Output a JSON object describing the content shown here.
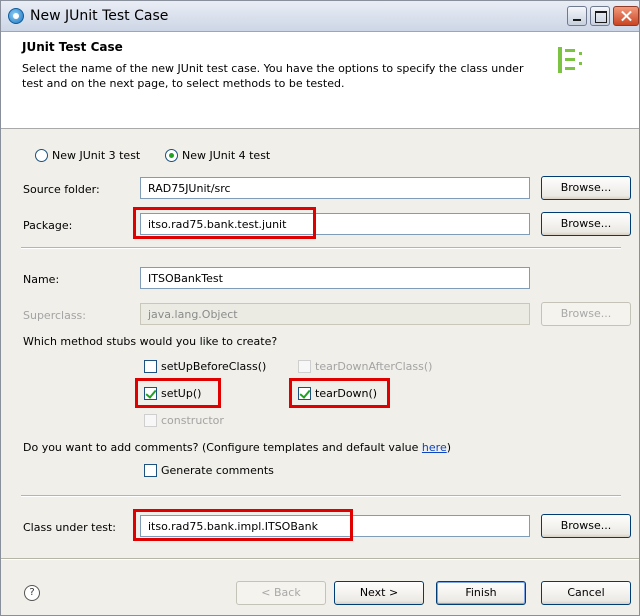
{
  "window": {
    "title": "New JUnit Test Case"
  },
  "header": {
    "title": "JUnit Test Case",
    "description": "Select the name of the new JUnit test case. You have the options to specify the class under test and on the next page, to select methods to be tested."
  },
  "version": {
    "option1": "New JUnit 3 test",
    "option2": "New JUnit 4 test",
    "selected": "New JUnit 4 test"
  },
  "fields": {
    "source_folder_label": "Source folder:",
    "source_folder_value": "RAD75JUnit/src",
    "package_label": "Package:",
    "package_value": "itso.rad75.bank.test.junit",
    "name_label": "Name:",
    "name_value": "ITSOBankTest",
    "superclass_label": "Superclass:",
    "superclass_value": "java.lang.Object",
    "class_under_test_label": "Class under test:",
    "class_under_test_value": "itso.rad75.bank.impl.ITSOBank"
  },
  "browse_label": "Browse...",
  "stubs": {
    "question": "Which method stubs would you like to create?",
    "setUpBeforeClass": "setUpBeforeClass()",
    "tearDownAfterClass": "tearDownAfterClass()",
    "setUp": "setUp()",
    "tearDown": "tearDown()",
    "constructor": "constructor"
  },
  "comments": {
    "question_prefix": "Do you want to add comments? (Configure templates and default value ",
    "link": "here",
    "question_suffix": ")",
    "generate": "Generate comments"
  },
  "footer": {
    "help": "?",
    "back": "< Back",
    "next": "Next >",
    "finish": "Finish",
    "cancel": "Cancel"
  },
  "colors": {
    "highlight": "#e00000",
    "link": "#0b45c4",
    "check": "#21a121"
  }
}
